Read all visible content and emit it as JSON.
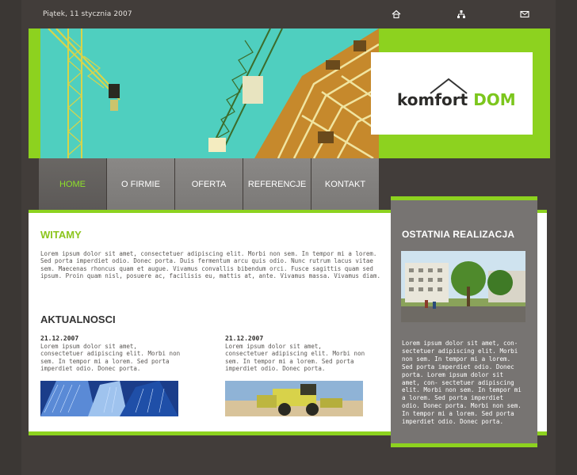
{
  "topbar": {
    "date": "Piątek, 11 stycznia 2007",
    "icons": [
      "home-icon",
      "sitemap-icon",
      "mail-icon"
    ]
  },
  "brand": {
    "logo_part1": "komfort",
    "logo_part2": "DOM",
    "accent_color": "#8dd21f"
  },
  "nav": {
    "items": [
      {
        "label": "HOME",
        "active": true
      },
      {
        "label": "O FIRMIE"
      },
      {
        "label": "OFERTA"
      },
      {
        "label": "REFERENCJE"
      },
      {
        "label": "KONTAKT"
      }
    ]
  },
  "welcome": {
    "title": "WITAMY",
    "text": "Lorem ipsum dolor sit amet, consectetuer adipiscing elit. Morbi non sem. In tempor mi a lorem. Sed porta imperdiet odio. Donec porta. Duis fermentum arcu quis odio. Nunc rutrum lacus vitae sem. Maecenas rhoncus quam et augue. Vivamus convallis bibendum orci. Fusce sagittis quam sed ipsum. Proin quam nisl, posuere ac, facilisis eu, mattis at, ante. Vivamus massa. Vivamus diam."
  },
  "news": {
    "title": "AKTUALNOSCI",
    "items": [
      {
        "date": "21.12.2007",
        "text": "Lorem ipsum dolor sit amet, consectetuer adipiscing elit. Morbi non sem. In tempor mi a lorem. Sed porta imperdiet odio. Donec porta."
      },
      {
        "date": "21.12.2007",
        "text": "Lorem ipsum dolor sit amet, consectetuer adipiscing elit. Morbi non sem. In tempor mi a lorem. Sed porta imperdiet odio. Donec porta."
      }
    ]
  },
  "sidebar": {
    "title": "OSTATNIA REALIZACJA",
    "text": "Lorem ipsum dolor sit amet, con- sectetuer adipiscing elit. Morbi non sem. In tempor mi a lorem. Sed porta imperdiet odio. Donec porta. Lorem ipsum dolor sit amet, con- sectetuer adipiscing elit. Morbi non sem. In tempor mi a lorem. Sed porta imperdiet odio. Donec porta. Morbi non sem. In tempor mi a lorem. Sed porta imperdiet odio. Donec porta."
  }
}
